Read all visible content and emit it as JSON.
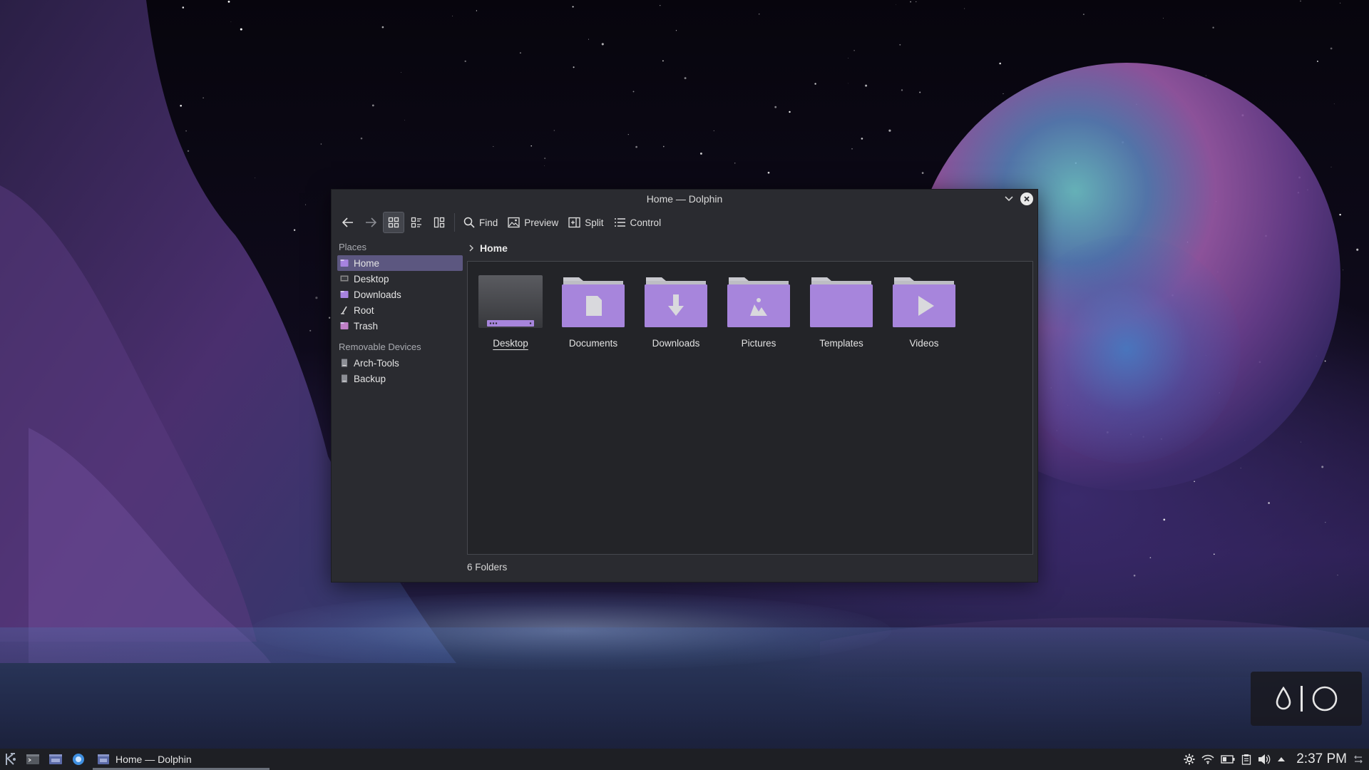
{
  "window": {
    "title": "Home — Dolphin"
  },
  "toolbar": {
    "back": "back",
    "forward": "forward",
    "find": "Find",
    "preview": "Preview",
    "split": "Split",
    "control": "Control"
  },
  "places": {
    "heading": "Places",
    "items": [
      {
        "label": "Home",
        "icon": "home-folder-icon",
        "color": "#a783e0",
        "active": true
      },
      {
        "label": "Desktop",
        "icon": "desktop-icon",
        "color": "#8a8a8a"
      },
      {
        "label": "Downloads",
        "icon": "downloads-folder-icon",
        "color": "#a783e0"
      },
      {
        "label": "Root",
        "icon": "root-slash-icon",
        "color": "#dddddd"
      },
      {
        "label": "Trash",
        "icon": "trash-icon",
        "color": "#c080c8"
      }
    ]
  },
  "removable": {
    "heading": "Removable Devices",
    "items": [
      {
        "label": "Arch-Tools",
        "icon": "drive-icon"
      },
      {
        "label": "Backup",
        "icon": "drive-icon"
      }
    ]
  },
  "breadcrumb": {
    "current": "Home"
  },
  "folders": [
    {
      "label": "Desktop",
      "icon": "desktop-folder-icon",
      "selected": true
    },
    {
      "label": "Documents",
      "icon": "documents-folder-icon"
    },
    {
      "label": "Downloads",
      "icon": "downloads-folder-icon"
    },
    {
      "label": "Pictures",
      "icon": "pictures-folder-icon"
    },
    {
      "label": "Templates",
      "icon": "templates-folder-icon"
    },
    {
      "label": "Videos",
      "icon": "videos-folder-icon"
    }
  ],
  "status": {
    "summary": "6 Folders"
  },
  "taskbar": {
    "task_label": "Home — Dolphin",
    "clock": "2:37 PM"
  },
  "colors": {
    "accent": "#a783e0",
    "folder_body": "#a785dc",
    "folder_tab": "#c9c9cf",
    "selection": "#5c5780"
  }
}
